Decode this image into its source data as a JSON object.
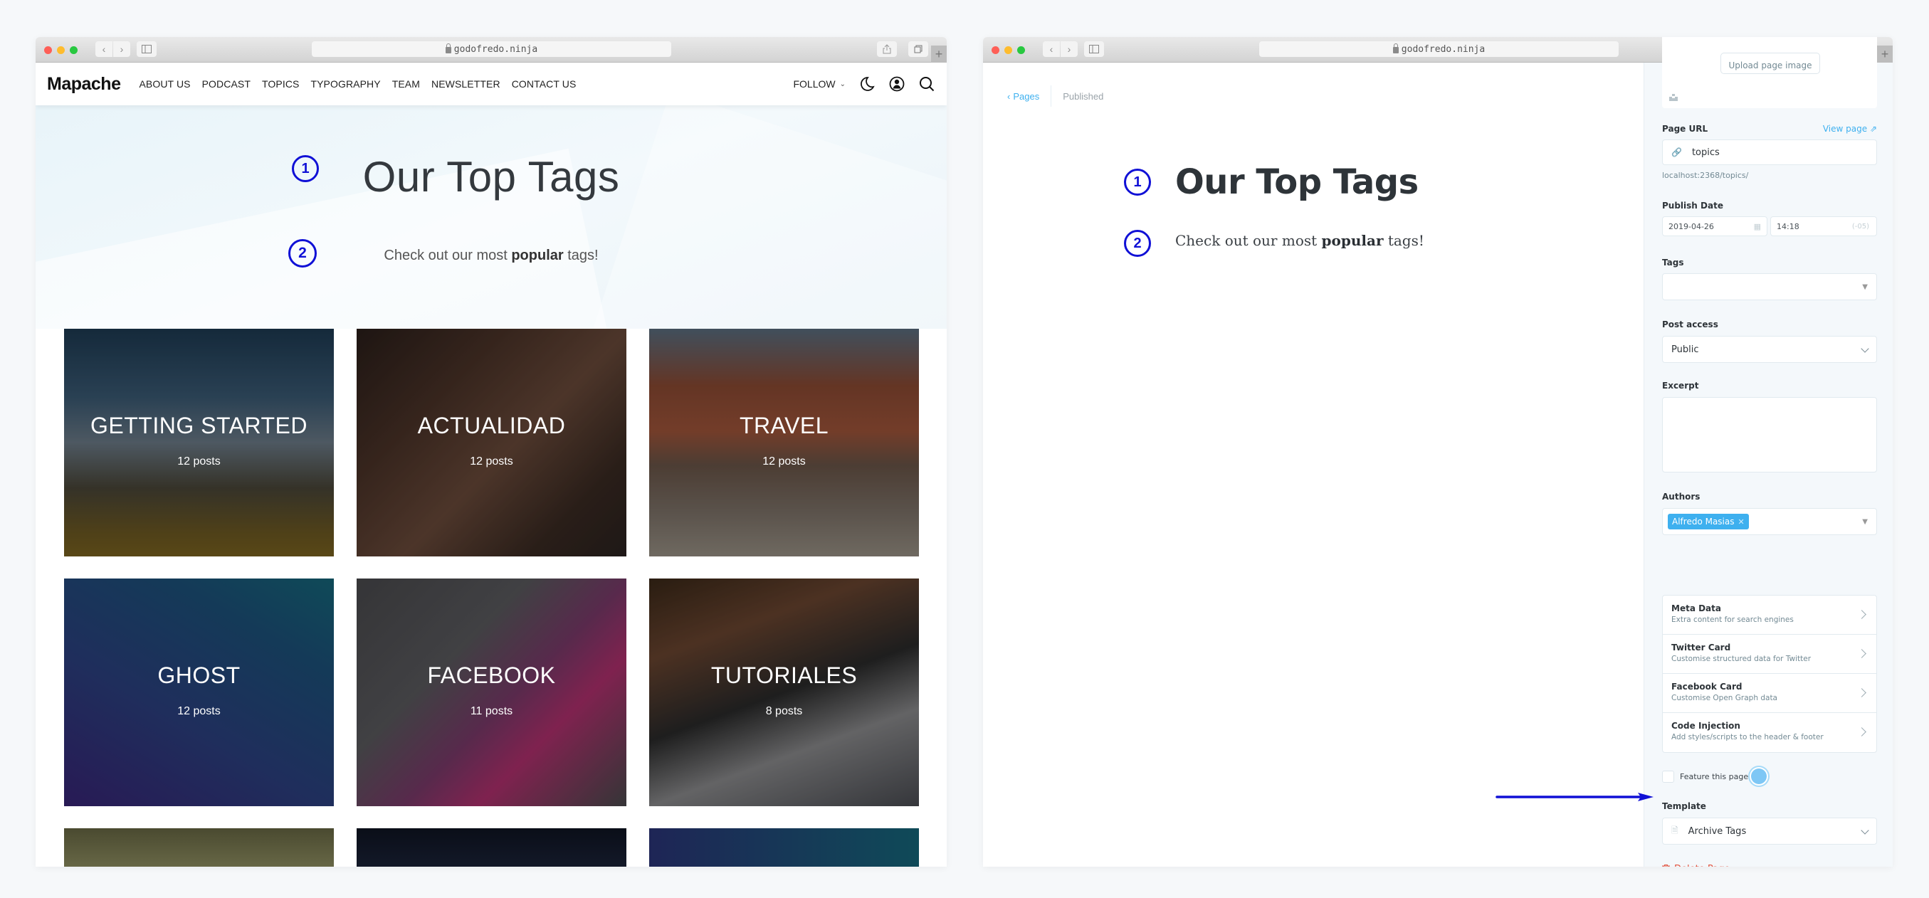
{
  "browser": {
    "url": "godofredo.ninja",
    "buttons": {
      "back": "‹",
      "forward": "›",
      "new_tab": "+"
    }
  },
  "site": {
    "logo": "Mapache",
    "nav": [
      "ABOUT US",
      "PODCAST",
      "TOPICS",
      "TYPOGRAPHY",
      "TEAM",
      "NEWSLETTER",
      "CONTACT US"
    ],
    "follow_label": "FOLLOW",
    "hero": {
      "title": "Our Top Tags",
      "subtitle_pre": "Check out our most ",
      "subtitle_bold": "popular",
      "subtitle_post": " tags!"
    },
    "tags": [
      {
        "name": "GETTING STARTED",
        "count": "12 posts"
      },
      {
        "name": "ACTUALIDAD",
        "count": "12 posts"
      },
      {
        "name": "TRAVEL",
        "count": "12 posts"
      },
      {
        "name": "GHOST",
        "count": "12 posts"
      },
      {
        "name": "FACEBOOK",
        "count": "11 posts"
      },
      {
        "name": "TUTORIALES",
        "count": "8 posts"
      }
    ]
  },
  "annotations": {
    "marker_1": "1",
    "marker_2": "2"
  },
  "editor": {
    "breadcrumb_back": "Pages",
    "status": "Published",
    "title": "Our Top Tags",
    "body_pre": "Check out our most ",
    "body_bold": "popular",
    "body_post": " tags!"
  },
  "settings": {
    "upload_image_label": "Upload page image",
    "page_url_label": "Page URL",
    "view_page_label": "View page",
    "page_url_value": "topics",
    "page_url_hint": "localhost:2368/topics/",
    "publish_date_label": "Publish Date",
    "publish_date": "2019-04-26",
    "publish_time": "14:18",
    "timezone": "(-05)",
    "tags_label": "Tags",
    "post_access_label": "Post access",
    "post_access_value": "Public",
    "excerpt_label": "Excerpt",
    "excerpt_value": "",
    "authors_label": "Authors",
    "authors": [
      "Alfredo Masias"
    ],
    "sub_menus": [
      {
        "title": "Meta Data",
        "desc": "Extra content for search engines"
      },
      {
        "title": "Twitter Card",
        "desc": "Customise structured data for Twitter"
      },
      {
        "title": "Facebook Card",
        "desc": "Customise Open Graph data"
      },
      {
        "title": "Code Injection",
        "desc": "Add styles/scripts to the header & footer"
      }
    ],
    "feature_label": "Feature this page",
    "feature_checked": false,
    "template_label": "Template",
    "template_value": "Archive Tags",
    "delete_label": "Delete Page"
  },
  "colors": {
    "accent_blue": "#3eb0ef",
    "annotation_blue": "#1010d6",
    "delete_red": "#e25440"
  }
}
